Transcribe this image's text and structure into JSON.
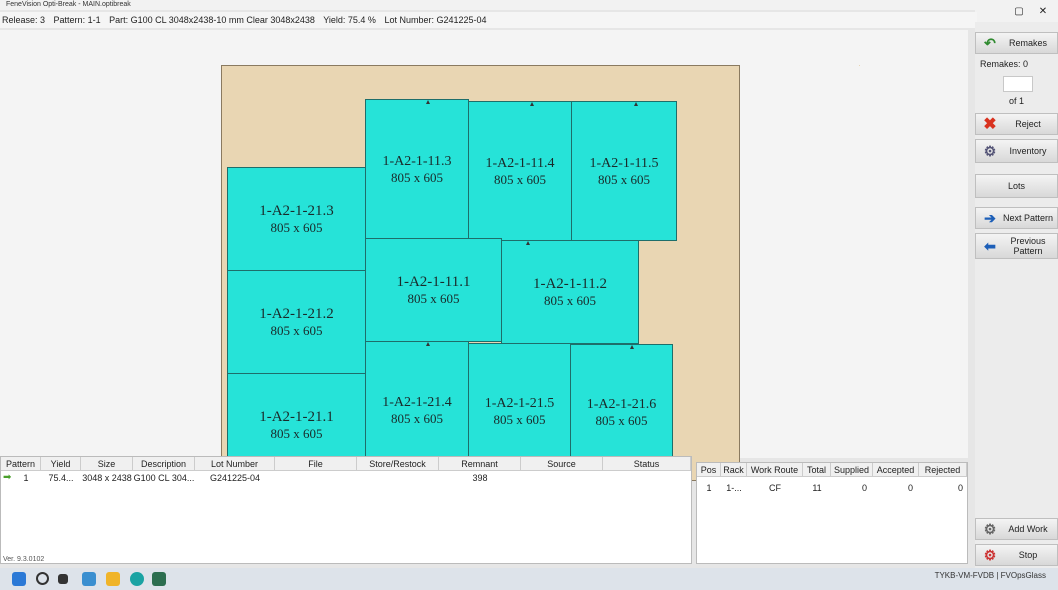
{
  "window": {
    "title": "FeneVision Opti-Break - MAIN.optibreak",
    "controls": {
      "minimize": "▢",
      "close": "✕"
    }
  },
  "info": {
    "release": "Release: 3",
    "pattern": "Pattern: 1-1",
    "part": "Part: G100 CL 3048x2438-10 mm Clear 3048x2438",
    "yield": "Yield: 75.4 %",
    "lot": "Lot Number: G241225-04"
  },
  "pieces": [
    {
      "id": "1-A2-1-11.3",
      "size": "805 x 605"
    },
    {
      "id": "1-A2-1-11.4",
      "size": "805 x 605"
    },
    {
      "id": "1-A2-1-11.5",
      "size": "805 x 605"
    },
    {
      "id": "1-A2-1-21.3",
      "size": "805 x 605"
    },
    {
      "id": "1-A2-1-11.1",
      "size": "805 x 605"
    },
    {
      "id": "1-A2-1-11.2",
      "size": "805 x 605"
    },
    {
      "id": "1-A2-1-21.2",
      "size": "805 x 605"
    },
    {
      "id": "1-A2-1-21.4",
      "size": "805 x 605"
    },
    {
      "id": "1-A2-1-21.5",
      "size": "805 x 605"
    },
    {
      "id": "1-A2-1-21.6",
      "size": "805 x 605"
    },
    {
      "id": "1-A2-1-21.1",
      "size": "805 x 605"
    }
  ],
  "sidebar": {
    "remakes": "Remakes",
    "remakes_count": "Remakes: 0",
    "of": "of 1",
    "reject": "Reject",
    "inventory": "Inventory",
    "lots": "Lots",
    "next_pattern": "Next Pattern",
    "previous_pattern": "Previous Pattern",
    "add_work": "Add Work",
    "stop": "Stop"
  },
  "pattern_table": {
    "headers": [
      "Pattern",
      "Yield",
      "Size",
      "Description",
      "Lot Number",
      "File",
      "Store/Restock",
      "Remnant",
      "Source",
      "Status"
    ],
    "rows": [
      [
        "1",
        "75.4...",
        "3048 x 2438",
        "G100 CL 304...",
        "G241225-04",
        "",
        "",
        "398",
        "",
        ""
      ]
    ]
  },
  "work_table": {
    "headers": [
      "Pos",
      "Rack",
      "Work Route",
      "Total",
      "Supplied",
      "Accepted",
      "Rejected"
    ],
    "rows": [
      [
        "1",
        "1-...",
        "CF",
        "11",
        "0",
        "0",
        "0"
      ]
    ]
  },
  "status": {
    "version": "Ver. 9.3.0102",
    "machine": "TYKB-VM-FVDB | FVOpsGlass"
  },
  "colors": {
    "piece": "#26e3d8",
    "remnant": "#e9d6b3"
  }
}
